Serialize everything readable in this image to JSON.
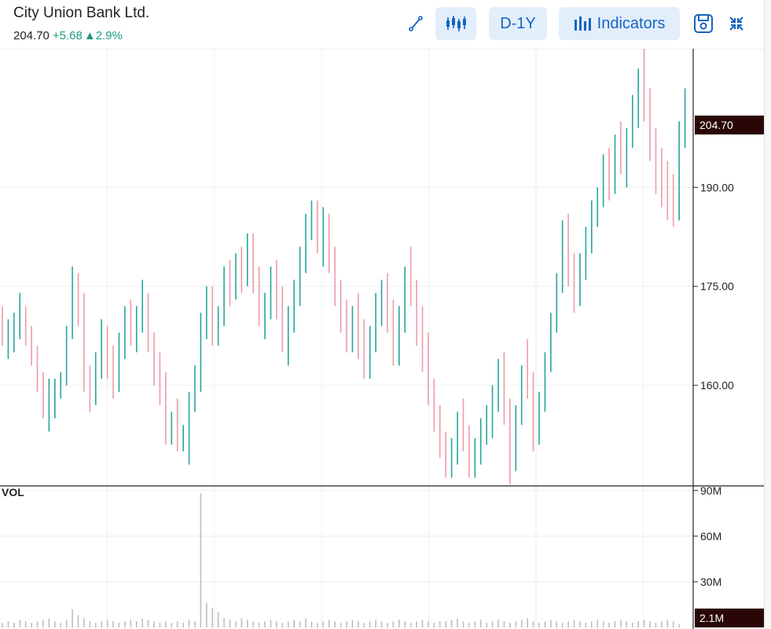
{
  "header": {
    "title": "City Union Bank Ltd.",
    "price": "204.70",
    "change": "+5.68",
    "change_pct": "▲2.9%"
  },
  "toolbar": {
    "draw_icon": "line-draw-icon",
    "candle_icon": "candlestick-icon",
    "range_label": "D-1Y",
    "indicators_label": "Indicators",
    "indicators_icon": "bar-chart-icon",
    "save_icon": "save-icon",
    "collapse_icon": "collapse-icon"
  },
  "colors": {
    "up": "#26a69a",
    "down": "#ef9aa8",
    "accent": "#1565c0",
    "accent_bg": "#e3eefb",
    "price_tag": "#2a0606"
  },
  "chart_data": {
    "type": "ohlc",
    "price_axis": {
      "min": 145,
      "max": 211,
      "ticks": [
        "160.00",
        "175.00",
        "190.00"
      ]
    },
    "last_price_label": "204.70",
    "volume_label": "VOL",
    "volume_axis": {
      "min": 0,
      "max": 90,
      "ticks": [
        "30M",
        "60M",
        "90M"
      ]
    },
    "last_volume_label": "2.1M",
    "bars": [
      [
        168,
        172,
        166,
        167
      ],
      [
        166,
        170,
        164,
        167
      ],
      [
        167,
        171,
        165,
        169
      ],
      [
        169,
        174,
        167,
        171
      ],
      [
        171,
        172,
        166,
        167
      ],
      [
        167,
        169,
        163,
        164
      ],
      [
        164,
        166,
        159,
        161
      ],
      [
        161,
        162,
        155,
        157
      ],
      [
        157,
        161,
        153,
        158
      ],
      [
        158,
        161,
        155,
        159
      ],
      [
        159,
        162,
        158,
        161
      ],
      [
        161,
        169,
        160,
        168
      ],
      [
        168,
        178,
        167,
        175
      ],
      [
        175,
        177,
        169,
        171
      ],
      [
        171,
        174,
        159,
        161
      ],
      [
        161,
        163,
        156,
        158
      ],
      [
        158,
        165,
        157,
        163
      ],
      [
        163,
        170,
        161,
        167
      ],
      [
        167,
        169,
        161,
        164
      ],
      [
        164,
        166,
        158,
        161
      ],
      [
        161,
        168,
        159,
        166
      ],
      [
        166,
        172,
        164,
        170
      ],
      [
        170,
        173,
        166,
        168
      ],
      [
        168,
        172,
        165,
        170
      ],
      [
        170,
        176,
        168,
        174
      ],
      [
        174,
        174,
        165,
        166
      ],
      [
        166,
        168,
        160,
        162
      ],
      [
        162,
        165,
        157,
        159
      ],
      [
        159,
        162,
        151,
        153
      ],
      [
        153,
        156,
        151,
        155
      ],
      [
        155,
        158,
        150,
        152
      ],
      [
        152,
        154,
        150,
        153
      ],
      [
        153,
        159,
        148,
        157
      ],
      [
        157,
        163,
        156,
        161
      ],
      [
        161,
        171,
        159,
        169
      ],
      [
        169,
        175,
        167,
        173
      ],
      [
        173,
        175,
        166,
        168
      ],
      [
        168,
        172,
        166,
        170
      ],
      [
        170,
        178,
        169,
        176
      ],
      [
        176,
        179,
        172,
        174
      ],
      [
        174,
        180,
        173,
        178
      ],
      [
        178,
        181,
        174,
        176
      ],
      [
        176,
        183,
        175,
        181
      ],
      [
        181,
        183,
        174,
        176
      ],
      [
        176,
        178,
        169,
        170
      ],
      [
        170,
        174,
        167,
        172
      ],
      [
        172,
        178,
        170,
        176
      ],
      [
        176,
        179,
        170,
        172
      ],
      [
        172,
        175,
        165,
        167
      ],
      [
        167,
        172,
        163,
        170
      ],
      [
        170,
        176,
        168,
        175
      ],
      [
        175,
        181,
        172,
        179
      ],
      [
        179,
        186,
        177,
        184
      ],
      [
        184,
        188,
        182,
        186
      ],
      [
        186,
        188,
        180,
        181
      ],
      [
        181,
        187,
        178,
        185
      ],
      [
        185,
        186,
        177,
        179
      ],
      [
        179,
        181,
        172,
        174
      ],
      [
        174,
        176,
        168,
        170
      ],
      [
        170,
        173,
        165,
        167
      ],
      [
        167,
        172,
        165,
        169
      ],
      [
        169,
        174,
        164,
        166
      ],
      [
        166,
        170,
        161,
        163
      ],
      [
        163,
        169,
        161,
        167
      ],
      [
        167,
        174,
        165,
        172
      ],
      [
        172,
        176,
        169,
        174
      ],
      [
        174,
        177,
        168,
        170
      ],
      [
        170,
        173,
        163,
        165
      ],
      [
        165,
        172,
        163,
        170
      ],
      [
        170,
        178,
        168,
        176
      ],
      [
        176,
        181,
        172,
        174
      ],
      [
        174,
        176,
        166,
        168
      ],
      [
        168,
        172,
        162,
        164
      ],
      [
        164,
        168,
        157,
        159
      ],
      [
        159,
        161,
        153,
        155
      ],
      [
        155,
        157,
        149,
        151
      ],
      [
        151,
        153,
        146,
        148
      ],
      [
        148,
        152,
        146,
        150
      ],
      [
        150,
        156,
        148,
        154
      ],
      [
        154,
        158,
        150,
        152
      ],
      [
        152,
        154,
        146,
        148
      ],
      [
        148,
        152,
        146,
        150
      ],
      [
        150,
        155,
        148,
        153
      ],
      [
        153,
        157,
        151,
        155
      ],
      [
        155,
        160,
        152,
        158
      ],
      [
        158,
        164,
        156,
        162
      ],
      [
        162,
        165,
        154,
        156
      ],
      [
        156,
        158,
        145,
        148
      ],
      [
        148,
        157,
        147,
        155
      ],
      [
        155,
        163,
        154,
        161
      ],
      [
        161,
        167,
        158,
        160
      ],
      [
        160,
        162,
        150,
        152
      ],
      [
        152,
        159,
        151,
        157
      ],
      [
        157,
        165,
        156,
        163
      ],
      [
        163,
        171,
        162,
        169
      ],
      [
        169,
        177,
        168,
        175
      ],
      [
        175,
        185,
        174,
        183
      ],
      [
        183,
        186,
        175,
        177
      ],
      [
        177,
        180,
        171,
        173
      ],
      [
        173,
        180,
        172,
        178
      ],
      [
        178,
        184,
        176,
        182
      ],
      [
        182,
        188,
        180,
        186
      ],
      [
        186,
        190,
        184,
        188
      ],
      [
        188,
        195,
        187,
        193
      ],
      [
        193,
        196,
        188,
        190
      ],
      [
        190,
        198,
        189,
        196
      ],
      [
        196,
        200,
        192,
        194
      ],
      [
        194,
        199,
        190,
        197
      ],
      [
        197,
        204,
        196,
        202
      ],
      [
        202,
        208,
        199,
        205
      ],
      [
        205,
        211,
        200,
        203
      ],
      [
        203,
        205,
        194,
        196
      ],
      [
        196,
        199,
        189,
        192
      ],
      [
        192,
        196,
        187,
        190
      ],
      [
        190,
        194,
        185,
        188
      ],
      [
        188,
        192,
        184,
        186
      ],
      [
        186,
        200,
        185,
        197
      ],
      [
        197,
        205,
        196,
        204
      ]
    ],
    "volumes": [
      3,
      4,
      3,
      5,
      4,
      3,
      4,
      5,
      6,
      4,
      3,
      5,
      12,
      8,
      6,
      4,
      3,
      4,
      5,
      4,
      3,
      4,
      5,
      4,
      6,
      5,
      4,
      3,
      4,
      3,
      4,
      3,
      5,
      4,
      88,
      16,
      13,
      10,
      6,
      5,
      4,
      6,
      5,
      4,
      3,
      4,
      5,
      4,
      3,
      4,
      5,
      4,
      6,
      4,
      3,
      4,
      5,
      4,
      3,
      4,
      5,
      4,
      3,
      4,
      5,
      4,
      3,
      4,
      5,
      4,
      3,
      4,
      5,
      4,
      3,
      4,
      4,
      5,
      6,
      4,
      3,
      4,
      5,
      3,
      4,
      5,
      4,
      3,
      4,
      5,
      6,
      4,
      3,
      4,
      5,
      4,
      3,
      4,
      5,
      4,
      3,
      4,
      5,
      4,
      3,
      4,
      5,
      4,
      3,
      4,
      5,
      4,
      3,
      4,
      5,
      4,
      2
    ]
  }
}
